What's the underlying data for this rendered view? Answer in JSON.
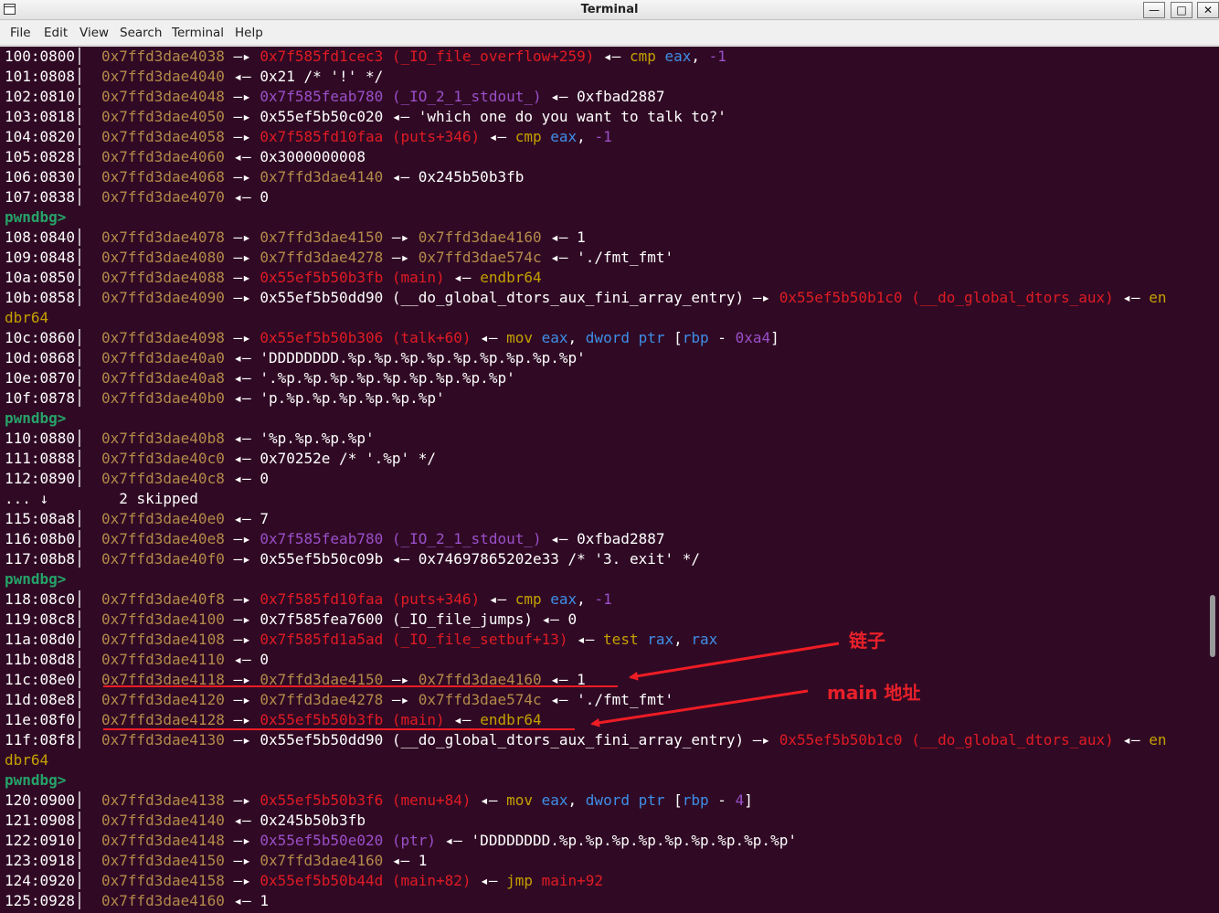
{
  "window": {
    "title": "Terminal",
    "buttons": {
      "minimize": "—",
      "maximize": "□",
      "close": "✕"
    }
  },
  "menu": [
    "File",
    "Edit",
    "View",
    "Search",
    "Terminal",
    "Help"
  ],
  "colors": {
    "background": "#300a24",
    "address": "#b48a4a",
    "code_pointer": "#e01b24",
    "data_pointer": "#9a4fc9",
    "instruction": "#c4a000",
    "register": "#3e8ee8",
    "prompt": "#26a269",
    "annotation": "#e8202a"
  },
  "terminal_lines": [
    [
      [
        "s",
        "100:0800│  "
      ],
      [
        "a",
        "0x7ffd3dae4038"
      ],
      [
        "s",
        " —▸ "
      ],
      [
        "r",
        "0x7f585fd1cec3 (_IO_file_overflow+259)"
      ],
      [
        "s",
        " ◂— "
      ],
      [
        "y",
        "cmp"
      ],
      [
        "s",
        " "
      ],
      [
        "b",
        "eax"
      ],
      [
        "s",
        ", "
      ],
      [
        "m",
        "-1"
      ]
    ],
    [
      [
        "s",
        "101:0808│  "
      ],
      [
        "a",
        "0x7ffd3dae4040"
      ],
      [
        "s",
        " ◂— 0x21 /* '!' */"
      ]
    ],
    [
      [
        "s",
        "102:0810│  "
      ],
      [
        "a",
        "0x7ffd3dae4048"
      ],
      [
        "s",
        " —▸ "
      ],
      [
        "m",
        "0x7f585feab780 (_IO_2_1_stdout_)"
      ],
      [
        "s",
        " ◂— 0xfbad2887"
      ]
    ],
    [
      [
        "s",
        "103:0818│  "
      ],
      [
        "a",
        "0x7ffd3dae4050"
      ],
      [
        "s",
        " —▸ 0x55ef5b50c020 ◂— 'which one do you want to talk to?'"
      ]
    ],
    [
      [
        "s",
        "104:0820│  "
      ],
      [
        "a",
        "0x7ffd3dae4058"
      ],
      [
        "s",
        " —▸ "
      ],
      [
        "r",
        "0x7f585fd10faa (puts+346)"
      ],
      [
        "s",
        " ◂— "
      ],
      [
        "y",
        "cmp"
      ],
      [
        "s",
        " "
      ],
      [
        "b",
        "eax"
      ],
      [
        "s",
        ", "
      ],
      [
        "m",
        "-1"
      ]
    ],
    [
      [
        "s",
        "105:0828│  "
      ],
      [
        "a",
        "0x7ffd3dae4060"
      ],
      [
        "s",
        " ◂— 0x3000000008"
      ]
    ],
    [
      [
        "s",
        "106:0830│  "
      ],
      [
        "a",
        "0x7ffd3dae4068"
      ],
      [
        "s",
        " —▸ "
      ],
      [
        "a",
        "0x7ffd3dae4140"
      ],
      [
        "s",
        " ◂— 0x245b50b3fb"
      ]
    ],
    [
      [
        "s",
        "107:0838│  "
      ],
      [
        "a",
        "0x7ffd3dae4070"
      ],
      [
        "s",
        " ◂— 0"
      ]
    ],
    [
      [
        "g",
        "pwndbg>"
      ]
    ],
    [
      [
        "s",
        "108:0840│  "
      ],
      [
        "a",
        "0x7ffd3dae4078"
      ],
      [
        "s",
        " —▸ "
      ],
      [
        "a",
        "0x7ffd3dae4150"
      ],
      [
        "s",
        " —▸ "
      ],
      [
        "a",
        "0x7ffd3dae4160"
      ],
      [
        "s",
        " ◂— 1"
      ]
    ],
    [
      [
        "s",
        "109:0848│  "
      ],
      [
        "a",
        "0x7ffd3dae4080"
      ],
      [
        "s",
        " —▸ "
      ],
      [
        "a",
        "0x7ffd3dae4278"
      ],
      [
        "s",
        " —▸ "
      ],
      [
        "a",
        "0x7ffd3dae574c"
      ],
      [
        "s",
        " ◂— './fmt_fmt'"
      ]
    ],
    [
      [
        "s",
        "10a:0850│  "
      ],
      [
        "a",
        "0x7ffd3dae4088"
      ],
      [
        "s",
        " —▸ "
      ],
      [
        "r",
        "0x55ef5b50b3fb (main)"
      ],
      [
        "s",
        " ◂— "
      ],
      [
        "y",
        "endbr64"
      ]
    ],
    [
      [
        "s",
        "10b:0858│  "
      ],
      [
        "a",
        "0x7ffd3dae4090"
      ],
      [
        "s",
        " —▸ 0x55ef5b50dd90 (__do_global_dtors_aux_fini_array_entry) —▸ "
      ],
      [
        "r",
        "0x55ef5b50b1c0 (__do_global_dtors_aux)"
      ],
      [
        "s",
        " ◂— "
      ],
      [
        "y",
        "en"
      ]
    ],
    [
      [
        "y",
        "dbr64"
      ]
    ],
    [
      [
        "s",
        "10c:0860│  "
      ],
      [
        "a",
        "0x7ffd3dae4098"
      ],
      [
        "s",
        " —▸ "
      ],
      [
        "r",
        "0x55ef5b50b306 (talk+60)"
      ],
      [
        "s",
        " ◂— "
      ],
      [
        "y",
        "mov"
      ],
      [
        "s",
        " "
      ],
      [
        "b",
        "eax"
      ],
      [
        "s",
        ", "
      ],
      [
        "b",
        "dword ptr"
      ],
      [
        "s",
        " ["
      ],
      [
        "b",
        "rbp"
      ],
      [
        "s",
        " - "
      ],
      [
        "m",
        "0xa4"
      ],
      [
        "s",
        "]"
      ]
    ],
    [
      [
        "s",
        "10d:0868│  "
      ],
      [
        "a",
        "0x7ffd3dae40a0"
      ],
      [
        "s",
        " ◂— 'DDDDDDDD.%p.%p.%p.%p.%p.%p.%p.%p.%p'"
      ]
    ],
    [
      [
        "s",
        "10e:0870│  "
      ],
      [
        "a",
        "0x7ffd3dae40a8"
      ],
      [
        "s",
        " ◂— '.%p.%p.%p.%p.%p.%p.%p.%p.%p'"
      ]
    ],
    [
      [
        "s",
        "10f:0878│  "
      ],
      [
        "a",
        "0x7ffd3dae40b0"
      ],
      [
        "s",
        " ◂— 'p.%p.%p.%p.%p.%p.%p'"
      ]
    ],
    [
      [
        "g",
        "pwndbg>"
      ]
    ],
    [
      [
        "s",
        "110:0880│  "
      ],
      [
        "a",
        "0x7ffd3dae40b8"
      ],
      [
        "s",
        " ◂— '%p.%p.%p.%p'"
      ]
    ],
    [
      [
        "s",
        "111:0888│  "
      ],
      [
        "a",
        "0x7ffd3dae40c0"
      ],
      [
        "s",
        " ◂— 0x70252e /* '.%p' */"
      ]
    ],
    [
      [
        "s",
        "112:0890│  "
      ],
      [
        "a",
        "0x7ffd3dae40c8"
      ],
      [
        "s",
        " ◂— 0"
      ]
    ],
    [
      [
        "s",
        "... ↓        2 skipped"
      ]
    ],
    [
      [
        "s",
        "115:08a8│  "
      ],
      [
        "a",
        "0x7ffd3dae40e0"
      ],
      [
        "s",
        " ◂— 7"
      ]
    ],
    [
      [
        "s",
        "116:08b0│  "
      ],
      [
        "a",
        "0x7ffd3dae40e8"
      ],
      [
        "s",
        " —▸ "
      ],
      [
        "m",
        "0x7f585feab780 (_IO_2_1_stdout_)"
      ],
      [
        "s",
        " ◂— 0xfbad2887"
      ]
    ],
    [
      [
        "s",
        "117:08b8│  "
      ],
      [
        "a",
        "0x7ffd3dae40f0"
      ],
      [
        "s",
        " —▸ 0x55ef5b50c09b ◂— 0x74697865202e33 /* '3. exit' */"
      ]
    ],
    [
      [
        "g",
        "pwndbg>"
      ]
    ],
    [
      [
        "s",
        "118:08c0│  "
      ],
      [
        "a",
        "0x7ffd3dae40f8"
      ],
      [
        "s",
        " —▸ "
      ],
      [
        "r",
        "0x7f585fd10faa (puts+346)"
      ],
      [
        "s",
        " ◂— "
      ],
      [
        "y",
        "cmp"
      ],
      [
        "s",
        " "
      ],
      [
        "b",
        "eax"
      ],
      [
        "s",
        ", "
      ],
      [
        "m",
        "-1"
      ]
    ],
    [
      [
        "s",
        "119:08c8│  "
      ],
      [
        "a",
        "0x7ffd3dae4100"
      ],
      [
        "s",
        " —▸ 0x7f585fea7600 (_IO_file_jumps) ◂— 0"
      ]
    ],
    [
      [
        "s",
        "11a:08d0│  "
      ],
      [
        "a",
        "0x7ffd3dae4108"
      ],
      [
        "s",
        " —▸ "
      ],
      [
        "r",
        "0x7f585fd1a5ad (_IO_file_setbuf+13)"
      ],
      [
        "s",
        " ◂— "
      ],
      [
        "y",
        "test"
      ],
      [
        "s",
        " "
      ],
      [
        "b",
        "rax"
      ],
      [
        "s",
        ", "
      ],
      [
        "b",
        "rax"
      ]
    ],
    [
      [
        "s",
        "11b:08d8│  "
      ],
      [
        "a",
        "0x7ffd3dae4110"
      ],
      [
        "s",
        " ◂— 0"
      ]
    ],
    [
      [
        "s",
        "11c:08e0│  "
      ],
      [
        "a",
        "0x7ffd3dae4118"
      ],
      [
        "s",
        " —▸ "
      ],
      [
        "a",
        "0x7ffd3dae4150"
      ],
      [
        "s",
        " —▸ "
      ],
      [
        "a",
        "0x7ffd3dae4160"
      ],
      [
        "s",
        " ◂— 1"
      ]
    ],
    [
      [
        "s",
        "11d:08e8│  "
      ],
      [
        "a",
        "0x7ffd3dae4120"
      ],
      [
        "s",
        " —▸ "
      ],
      [
        "a",
        "0x7ffd3dae4278"
      ],
      [
        "s",
        " —▸ "
      ],
      [
        "a",
        "0x7ffd3dae574c"
      ],
      [
        "s",
        " ◂— './fmt_fmt'"
      ]
    ],
    [
      [
        "s",
        "11e:08f0│  "
      ],
      [
        "a",
        "0x7ffd3dae4128"
      ],
      [
        "s",
        " —▸ "
      ],
      [
        "r",
        "0x55ef5b50b3fb (main)"
      ],
      [
        "s",
        " ◂— "
      ],
      [
        "y",
        "endbr64"
      ]
    ],
    [
      [
        "s",
        "11f:08f8│  "
      ],
      [
        "a",
        "0x7ffd3dae4130"
      ],
      [
        "s",
        " —▸ 0x55ef5b50dd90 (__do_global_dtors_aux_fini_array_entry) —▸ "
      ],
      [
        "r",
        "0x55ef5b50b1c0 (__do_global_dtors_aux)"
      ],
      [
        "s",
        " ◂— "
      ],
      [
        "y",
        "en"
      ]
    ],
    [
      [
        "y",
        "dbr64"
      ]
    ],
    [
      [
        "g",
        "pwndbg>"
      ]
    ],
    [
      [
        "s",
        "120:0900│  "
      ],
      [
        "a",
        "0x7ffd3dae4138"
      ],
      [
        "s",
        " —▸ "
      ],
      [
        "r",
        "0x55ef5b50b3f6 (menu+84)"
      ],
      [
        "s",
        " ◂— "
      ],
      [
        "y",
        "mov"
      ],
      [
        "s",
        " "
      ],
      [
        "b",
        "eax"
      ],
      [
        "s",
        ", "
      ],
      [
        "b",
        "dword ptr"
      ],
      [
        "s",
        " ["
      ],
      [
        "b",
        "rbp"
      ],
      [
        "s",
        " - "
      ],
      [
        "m",
        "4"
      ],
      [
        "s",
        "]"
      ]
    ],
    [
      [
        "s",
        "121:0908│  "
      ],
      [
        "a",
        "0x7ffd3dae4140"
      ],
      [
        "s",
        " ◂— 0x245b50b3fb"
      ]
    ],
    [
      [
        "s",
        "122:0910│  "
      ],
      [
        "a",
        "0x7ffd3dae4148"
      ],
      [
        "s",
        " —▸ "
      ],
      [
        "m",
        "0x55ef5b50e020 (ptr)"
      ],
      [
        "s",
        " ◂— 'DDDDDDDD.%p.%p.%p.%p.%p.%p.%p.%p.%p'"
      ]
    ],
    [
      [
        "s",
        "123:0918│  "
      ],
      [
        "a",
        "0x7ffd3dae4150"
      ],
      [
        "s",
        " —▸ "
      ],
      [
        "a",
        "0x7ffd3dae4160"
      ],
      [
        "s",
        " ◂— 1"
      ]
    ],
    [
      [
        "s",
        "124:0920│  "
      ],
      [
        "a",
        "0x7ffd3dae4158"
      ],
      [
        "s",
        " —▸ "
      ],
      [
        "r",
        "0x55ef5b50b44d (main+82)"
      ],
      [
        "s",
        " ◂— "
      ],
      [
        "y",
        "jmp"
      ],
      [
        "s",
        " "
      ],
      [
        "r",
        "main+92"
      ]
    ],
    [
      [
        "s",
        "125:0928│  "
      ],
      [
        "a",
        "0x7ffd3dae4160"
      ],
      [
        "s",
        " ◂— 1"
      ]
    ]
  ],
  "annotations": {
    "chain_label": "链子",
    "main_address_label": "main 地址"
  }
}
